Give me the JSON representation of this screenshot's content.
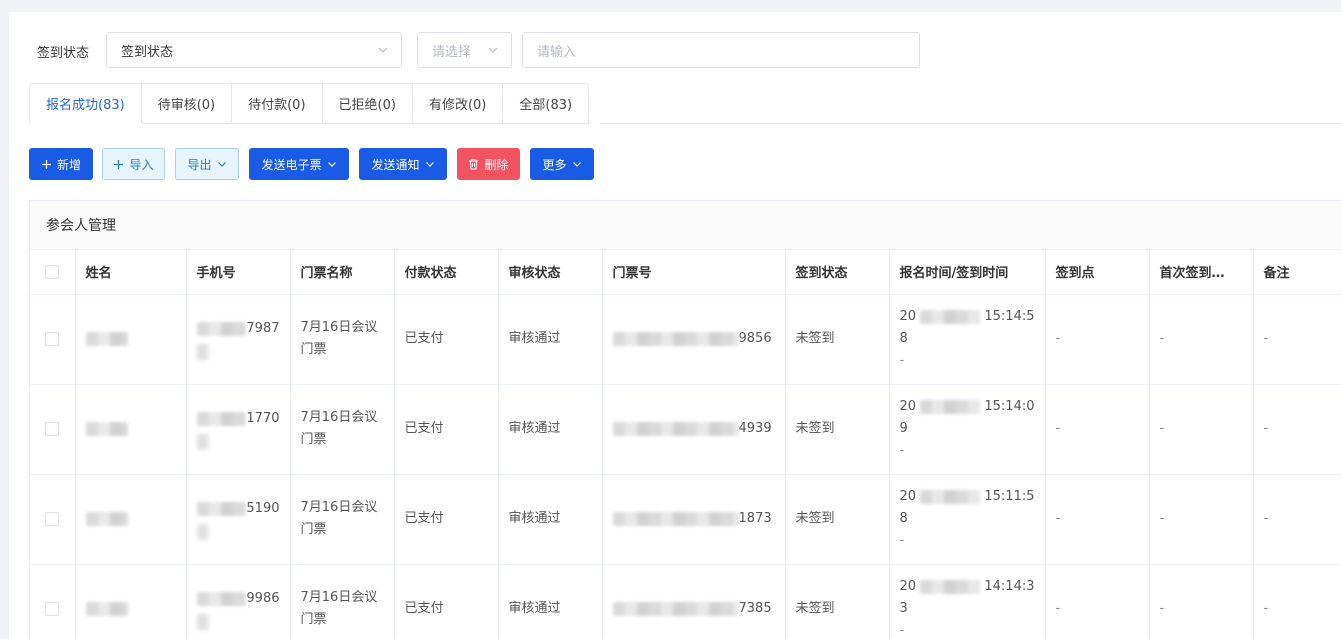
{
  "filters": {
    "label": "签到状态",
    "select1_value": "签到状态",
    "select2_placeholder": "请选择",
    "input_placeholder": "请输入"
  },
  "tabs": [
    {
      "label": "报名成功(83)",
      "active": true
    },
    {
      "label": "待审核(0)"
    },
    {
      "label": "待付款(0)"
    },
    {
      "label": "已拒绝(0)"
    },
    {
      "label": "有修改(0)"
    },
    {
      "label": "全部(83)"
    }
  ],
  "toolbar": {
    "add": "新增",
    "import": "导入",
    "export": "导出",
    "send_eticket": "发送电子票",
    "send_notice": "发送通知",
    "delete": "删除",
    "more": "更多"
  },
  "table": {
    "title": "参会人管理",
    "columns": [
      "姓名",
      "手机号",
      "门票名称",
      "付款状态",
      "审核状态",
      "门票号",
      "签到状态",
      "报名时间/签到时间",
      "签到点",
      "首次签到…",
      "备注"
    ],
    "rows": [
      {
        "phone_tail": "7987",
        "ticket_name": "7月16日会议门票",
        "pay": "已支付",
        "review": "审核通过",
        "ticket_tail": "9856",
        "checkin": "未签到",
        "time_prefix": "20",
        "time_suffix": "15:14:5",
        "time_line2": "8",
        "checkin_time": "-",
        "point": "-",
        "first": "-",
        "note": "-"
      },
      {
        "phone_tail": "1770",
        "ticket_name": "7月16日会议门票",
        "pay": "已支付",
        "review": "审核通过",
        "ticket_tail": "4939",
        "checkin": "未签到",
        "time_prefix": "20",
        "time_suffix": "15:14:0",
        "time_line2": "9",
        "checkin_time": "-",
        "point": "-",
        "first": "-",
        "note": "-"
      },
      {
        "phone_tail": "5190",
        "ticket_name": "7月16日会议门票",
        "pay": "已支付",
        "review": "审核通过",
        "ticket_tail": "1873",
        "checkin": "未签到",
        "time_prefix": "20",
        "time_suffix": "15:11:5",
        "time_line2": "8",
        "checkin_time": "-",
        "point": "-",
        "first": "-",
        "note": "-"
      },
      {
        "phone_tail": "9986",
        "ticket_name": "7月16日会议门票",
        "pay": "已支付",
        "review": "审核通过",
        "ticket_tail": "7385",
        "checkin": "未签到",
        "time_prefix": "20",
        "time_suffix": "14:14:3",
        "time_line2": "3",
        "checkin_time": "-",
        "point": "-",
        "first": "-",
        "note": "-"
      }
    ]
  },
  "colors": {
    "primary": "#1a5be6",
    "danger": "#f25360",
    "active_tab": "#2468d9"
  }
}
